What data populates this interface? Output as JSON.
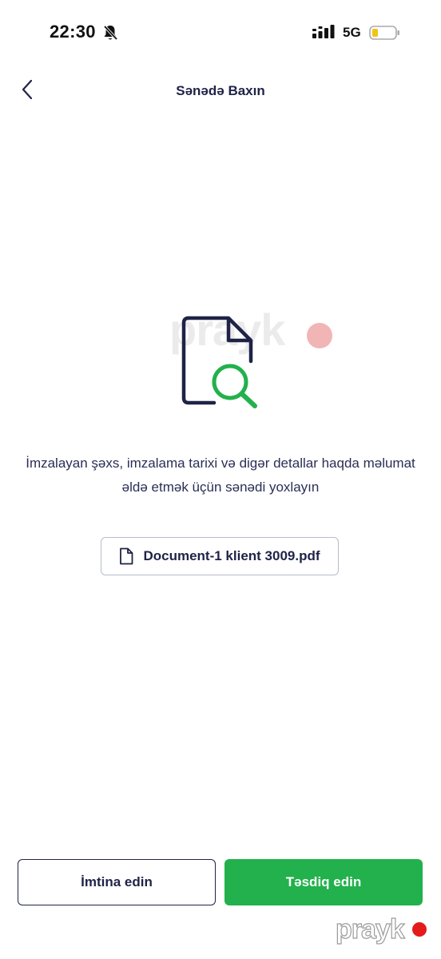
{
  "status_bar": {
    "time": "22:30",
    "network": "5G",
    "icons": [
      "bell-off-icon",
      "signal-icon",
      "battery-icon"
    ]
  },
  "header": {
    "title": "Sənədə Baxın",
    "back_icon": "chevron-left-icon"
  },
  "main": {
    "illustration": "document-search-icon",
    "description": "İmzalayan şəxs, imzalama tarixi və digər detallar haqda məlumat əldə etmək üçün sənədi yoxlayın",
    "file": {
      "name": "Document-1 klient 3009.pdf",
      "icon": "file-icon"
    }
  },
  "actions": {
    "cancel_label": "İmtina edin",
    "confirm_label": "Təsdiq edin"
  },
  "watermark": {
    "text": "prayk"
  },
  "colors": {
    "accent_green": "#22b14c",
    "navy": "#1f2346",
    "watermark_red": "#e41b1b"
  }
}
